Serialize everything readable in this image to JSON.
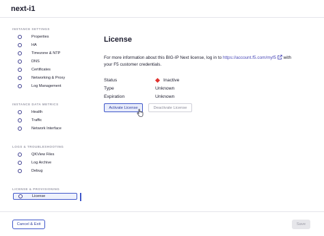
{
  "app": {
    "title": "next-i1"
  },
  "sidebar": {
    "sections": [
      {
        "title": "INSTANCE SETTINGS",
        "items": [
          {
            "label": "Properties"
          },
          {
            "label": "HA"
          },
          {
            "label": "Timezone & NTP"
          },
          {
            "label": "DNS"
          },
          {
            "label": "Certificates"
          },
          {
            "label": "Networking & Proxy"
          },
          {
            "label": "Log Management"
          }
        ]
      },
      {
        "title": "INSTANCE DATA METRICS",
        "items": [
          {
            "label": "Health"
          },
          {
            "label": "Traffic"
          },
          {
            "label": "Network Interface"
          }
        ]
      },
      {
        "title": "LOGS & TROUBLESHOOTING",
        "items": [
          {
            "label": "QKView Files"
          },
          {
            "label": "Log Archive"
          },
          {
            "label": "Debug"
          }
        ]
      },
      {
        "title": "LICENSE & PROVISIONING",
        "items": [
          {
            "label": "License",
            "active": true
          }
        ]
      }
    ]
  },
  "main": {
    "title": "License",
    "info_prefix": "For more information about this BIG-IP Next license, log in to ",
    "info_link": "https://account.f5.com/myf5",
    "info_mid": " with",
    "info_suffix": "your F5 customer credentials.",
    "fields": {
      "status_label": "Status",
      "status_value": "Inactive",
      "status_color": "#e0322e",
      "type_label": "Type",
      "type_value": "Unknown",
      "expiration_label": "Expiration",
      "expiration_value": "Unknown"
    },
    "buttons": {
      "activate": "Activate License",
      "deactivate": "Deactivate License"
    }
  },
  "footer": {
    "cancel": "Cancel & Exit",
    "save": "Save"
  }
}
